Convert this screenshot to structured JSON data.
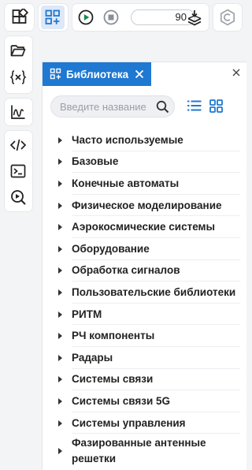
{
  "toolbar": {
    "sim_time": "90"
  },
  "library": {
    "tab_title": "Библиотека",
    "search_placeholder": "Введите название",
    "items": [
      {
        "label": "Часто используемые"
      },
      {
        "label": "Базовые"
      },
      {
        "label": "Конечные автоматы"
      },
      {
        "label": "Физическое моделирование"
      },
      {
        "label": "Аэрокосмические системы"
      },
      {
        "label": "Оборудование"
      },
      {
        "label": "Обработка сигналов"
      },
      {
        "label": "Пользовательские библиотеки"
      },
      {
        "label": "РИТМ"
      },
      {
        "label": "РЧ компоненты"
      },
      {
        "label": "Радары"
      },
      {
        "label": "Системы связи"
      },
      {
        "label": "Системы связи 5G"
      },
      {
        "label": "Системы управления"
      },
      {
        "label": "Фазированные антенные решетки"
      }
    ]
  },
  "colors": {
    "accent": "#1f78d1",
    "active_button_bg": "#dde8f8",
    "run_green": "#1a8a4e"
  }
}
